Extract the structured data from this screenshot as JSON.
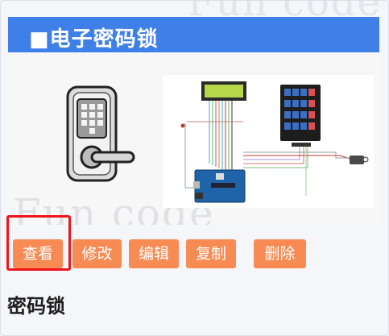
{
  "banner": {
    "title": "■电子密码锁"
  },
  "watermark": {
    "top": "Fun code",
    "middle": "Fun code"
  },
  "actions": {
    "view": "查看",
    "edit": "修改",
    "editor": "编辑",
    "copy": "复制",
    "delete": "删除"
  },
  "card": {
    "title": "密码锁"
  },
  "colors": {
    "banner": "#3f7fe8",
    "button": "#f78b53",
    "highlight": "#f0141c",
    "lcd": "#b4d84a",
    "keypad": "#3a6fc4",
    "arduino": "#1f63a8"
  },
  "icons": [
    "door-lock-icon",
    "circuit-diagram-icon"
  ]
}
